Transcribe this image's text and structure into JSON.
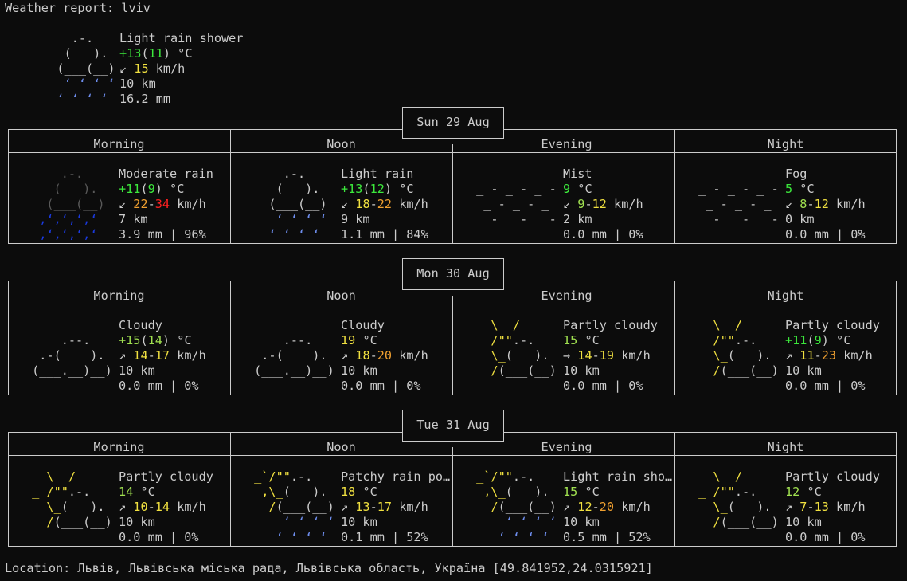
{
  "header": "Weather report: lviv",
  "current": {
    "art_name": "rain-cloud-icon",
    "desc": "Light rain shower",
    "temp": "+13",
    "feels": "11",
    "unit": "°C",
    "wind_arrow": "↙",
    "wind": "15",
    "wind_unit": "km/h",
    "visibility": "10 km",
    "precip": "16.2 mm"
  },
  "periods": [
    "Morning",
    "Noon",
    "Evening",
    "Night"
  ],
  "days": [
    {
      "date": "Sun 29 Aug",
      "cells": [
        {
          "art": "heavy-rain",
          "desc": "Moderate rain",
          "t1": "+11",
          "t2": "9",
          "tc1": "c-green",
          "tc2": "c-green",
          "arrow": "↙",
          "w1": "22",
          "w2": "34",
          "wc1": "c-orange",
          "wc2": "c-red",
          "vis": "7 km",
          "precip": "3.9 mm | 96%"
        },
        {
          "art": "light-rain",
          "desc": "Light rain",
          "t1": "+13",
          "t2": "12",
          "tc1": "c-green",
          "tc2": "c-green",
          "arrow": "↙",
          "w1": "18",
          "w2": "22",
          "wc1": "c-yellow",
          "wc2": "c-orange",
          "vis": "9 km",
          "precip": "1.1 mm | 84%"
        },
        {
          "art": "mist",
          "desc": "Mist",
          "t1": "9",
          "t2": "",
          "tc1": "c-green",
          "tc2": "",
          "arrow": "↙",
          "w1": "9",
          "w2": "12",
          "wc1": "c-lgreen",
          "wc2": "c-yellow",
          "vis": "2 km",
          "precip": "0.0 mm | 0%"
        },
        {
          "art": "mist",
          "desc": "Fog",
          "t1": "5",
          "t2": "",
          "tc1": "c-green",
          "tc2": "",
          "arrow": "↙",
          "w1": "8",
          "w2": "12",
          "wc1": "c-lgreen",
          "wc2": "c-yellow",
          "vis": "0 km",
          "precip": "0.0 mm | 0%"
        }
      ]
    },
    {
      "date": "Mon 30 Aug",
      "cells": [
        {
          "art": "cloudy",
          "desc": "Cloudy",
          "t1": "+15",
          "t2": "14",
          "tc1": "c-lgreen",
          "tc2": "c-lgreen",
          "arrow": "↗",
          "w1": "14",
          "w2": "17",
          "wc1": "c-yellow",
          "wc2": "c-yellow",
          "vis": "10 km",
          "precip": "0.0 mm | 0%"
        },
        {
          "art": "cloudy",
          "desc": "Cloudy",
          "t1": "19",
          "t2": "",
          "tc1": "c-yellow",
          "tc2": "",
          "arrow": "↗",
          "w1": "18",
          "w2": "20",
          "wc1": "c-yellow",
          "wc2": "c-orange",
          "vis": "10 km",
          "precip": "0.0 mm | 0%"
        },
        {
          "art": "partly-cloudy",
          "desc": "Partly cloudy",
          "t1": "15",
          "t2": "",
          "tc1": "c-lgreen",
          "tc2": "",
          "arrow": "→",
          "w1": "14",
          "w2": "19",
          "wc1": "c-yellow",
          "wc2": "c-yellow",
          "vis": "10 km",
          "precip": "0.0 mm | 0%"
        },
        {
          "art": "partly-cloudy",
          "desc": "Partly cloudy",
          "t1": "+11",
          "t2": "9",
          "tc1": "c-green",
          "tc2": "c-green",
          "arrow": "↗",
          "w1": "11",
          "w2": "23",
          "wc1": "c-yellow",
          "wc2": "c-orange",
          "vis": "10 km",
          "precip": "0.0 mm | 0%"
        }
      ]
    },
    {
      "date": "Tue 31 Aug",
      "cells": [
        {
          "art": "partly-cloudy",
          "desc": "Partly cloudy",
          "t1": "14",
          "t2": "",
          "tc1": "c-lgreen",
          "tc2": "",
          "arrow": "↗",
          "w1": "10",
          "w2": "14",
          "wc1": "c-yellow",
          "wc2": "c-yellow",
          "vis": "10 km",
          "precip": "0.0 mm | 0%"
        },
        {
          "art": "sun-rain",
          "desc": "Patchy rain po…",
          "t1": "18",
          "t2": "",
          "tc1": "c-yellow",
          "tc2": "",
          "arrow": "↗",
          "w1": "13",
          "w2": "17",
          "wc1": "c-yellow",
          "wc2": "c-yellow",
          "vis": "10 km",
          "precip": "0.1 mm | 52%"
        },
        {
          "art": "sun-rain",
          "desc": "Light rain sho…",
          "t1": "15",
          "t2": "",
          "tc1": "c-lgreen",
          "tc2": "",
          "arrow": "↗",
          "w1": "12",
          "w2": "20",
          "wc1": "c-yellow",
          "wc2": "c-orange",
          "vis": "10 km",
          "precip": "0.5 mm | 52%"
        },
        {
          "art": "partly-cloudy",
          "desc": "Partly cloudy",
          "t1": "12",
          "t2": "",
          "tc1": "c-lgreen",
          "tc2": "",
          "arrow": "↗",
          "w1": "7",
          "w2": "13",
          "wc1": "c-yellow",
          "wc2": "c-yellow",
          "vis": "10 km",
          "precip": "0.0 mm | 0%"
        }
      ]
    }
  ],
  "location": "Location: Львів, Львівська міська рада, Львівська область, Україна [49.841952,24.0315921]"
}
